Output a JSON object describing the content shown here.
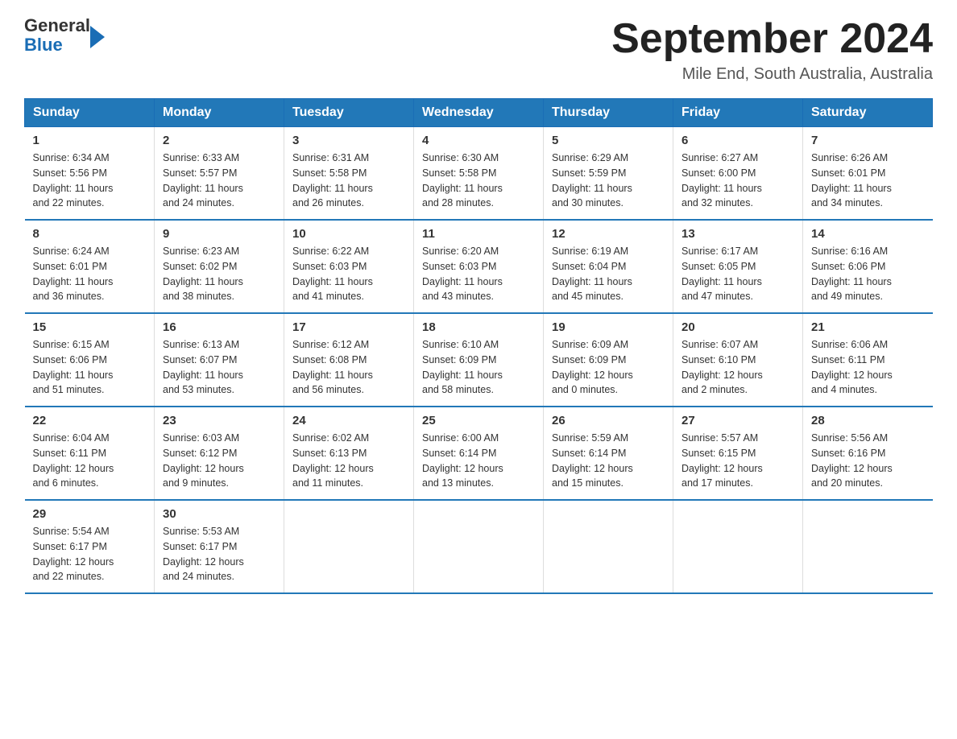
{
  "header": {
    "logo_general": "General",
    "logo_blue": "Blue",
    "title": "September 2024",
    "location": "Mile End, South Australia, Australia"
  },
  "weekdays": [
    "Sunday",
    "Monday",
    "Tuesday",
    "Wednesday",
    "Thursday",
    "Friday",
    "Saturday"
  ],
  "weeks": [
    [
      {
        "day": "1",
        "sunrise": "6:34 AM",
        "sunset": "5:56 PM",
        "daylight": "11 hours and 22 minutes."
      },
      {
        "day": "2",
        "sunrise": "6:33 AM",
        "sunset": "5:57 PM",
        "daylight": "11 hours and 24 minutes."
      },
      {
        "day": "3",
        "sunrise": "6:31 AM",
        "sunset": "5:58 PM",
        "daylight": "11 hours and 26 minutes."
      },
      {
        "day": "4",
        "sunrise": "6:30 AM",
        "sunset": "5:58 PM",
        "daylight": "11 hours and 28 minutes."
      },
      {
        "day": "5",
        "sunrise": "6:29 AM",
        "sunset": "5:59 PM",
        "daylight": "11 hours and 30 minutes."
      },
      {
        "day": "6",
        "sunrise": "6:27 AM",
        "sunset": "6:00 PM",
        "daylight": "11 hours and 32 minutes."
      },
      {
        "day": "7",
        "sunrise": "6:26 AM",
        "sunset": "6:01 PM",
        "daylight": "11 hours and 34 minutes."
      }
    ],
    [
      {
        "day": "8",
        "sunrise": "6:24 AM",
        "sunset": "6:01 PM",
        "daylight": "11 hours and 36 minutes."
      },
      {
        "day": "9",
        "sunrise": "6:23 AM",
        "sunset": "6:02 PM",
        "daylight": "11 hours and 38 minutes."
      },
      {
        "day": "10",
        "sunrise": "6:22 AM",
        "sunset": "6:03 PM",
        "daylight": "11 hours and 41 minutes."
      },
      {
        "day": "11",
        "sunrise": "6:20 AM",
        "sunset": "6:03 PM",
        "daylight": "11 hours and 43 minutes."
      },
      {
        "day": "12",
        "sunrise": "6:19 AM",
        "sunset": "6:04 PM",
        "daylight": "11 hours and 45 minutes."
      },
      {
        "day": "13",
        "sunrise": "6:17 AM",
        "sunset": "6:05 PM",
        "daylight": "11 hours and 47 minutes."
      },
      {
        "day": "14",
        "sunrise": "6:16 AM",
        "sunset": "6:06 PM",
        "daylight": "11 hours and 49 minutes."
      }
    ],
    [
      {
        "day": "15",
        "sunrise": "6:15 AM",
        "sunset": "6:06 PM",
        "daylight": "11 hours and 51 minutes."
      },
      {
        "day": "16",
        "sunrise": "6:13 AM",
        "sunset": "6:07 PM",
        "daylight": "11 hours and 53 minutes."
      },
      {
        "day": "17",
        "sunrise": "6:12 AM",
        "sunset": "6:08 PM",
        "daylight": "11 hours and 56 minutes."
      },
      {
        "day": "18",
        "sunrise": "6:10 AM",
        "sunset": "6:09 PM",
        "daylight": "11 hours and 58 minutes."
      },
      {
        "day": "19",
        "sunrise": "6:09 AM",
        "sunset": "6:09 PM",
        "daylight": "12 hours and 0 minutes."
      },
      {
        "day": "20",
        "sunrise": "6:07 AM",
        "sunset": "6:10 PM",
        "daylight": "12 hours and 2 minutes."
      },
      {
        "day": "21",
        "sunrise": "6:06 AM",
        "sunset": "6:11 PM",
        "daylight": "12 hours and 4 minutes."
      }
    ],
    [
      {
        "day": "22",
        "sunrise": "6:04 AM",
        "sunset": "6:11 PM",
        "daylight": "12 hours and 6 minutes."
      },
      {
        "day": "23",
        "sunrise": "6:03 AM",
        "sunset": "6:12 PM",
        "daylight": "12 hours and 9 minutes."
      },
      {
        "day": "24",
        "sunrise": "6:02 AM",
        "sunset": "6:13 PM",
        "daylight": "12 hours and 11 minutes."
      },
      {
        "day": "25",
        "sunrise": "6:00 AM",
        "sunset": "6:14 PM",
        "daylight": "12 hours and 13 minutes."
      },
      {
        "day": "26",
        "sunrise": "5:59 AM",
        "sunset": "6:14 PM",
        "daylight": "12 hours and 15 minutes."
      },
      {
        "day": "27",
        "sunrise": "5:57 AM",
        "sunset": "6:15 PM",
        "daylight": "12 hours and 17 minutes."
      },
      {
        "day": "28",
        "sunrise": "5:56 AM",
        "sunset": "6:16 PM",
        "daylight": "12 hours and 20 minutes."
      }
    ],
    [
      {
        "day": "29",
        "sunrise": "5:54 AM",
        "sunset": "6:17 PM",
        "daylight": "12 hours and 22 minutes."
      },
      {
        "day": "30",
        "sunrise": "5:53 AM",
        "sunset": "6:17 PM",
        "daylight": "12 hours and 24 minutes."
      },
      null,
      null,
      null,
      null,
      null
    ]
  ]
}
